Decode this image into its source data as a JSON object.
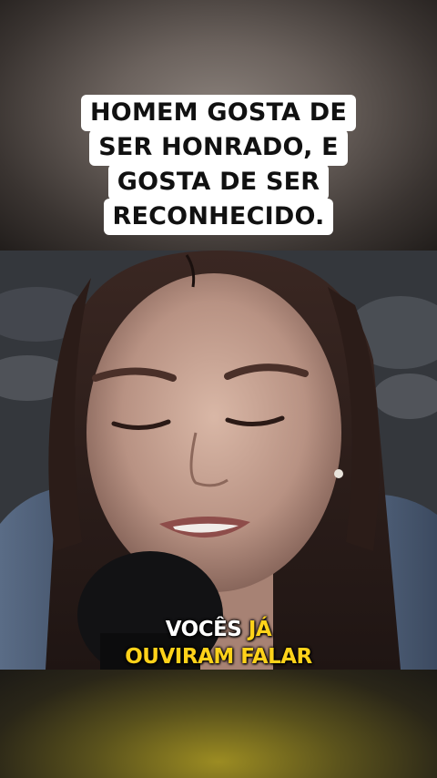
{
  "caption": {
    "lines": [
      "HOMEM GOSTA DE",
      "SER HONRADO, E",
      "GOSTA DE SER",
      "RECONHECIDO."
    ]
  },
  "subtitle": {
    "line1_white": "VOCÊS",
    "line1_yellow": "JÁ",
    "line2_yellow": "OUVIRAM FALAR"
  },
  "colors": {
    "subtitle_highlight": "#ffd21a",
    "caption_background": "#ffffff"
  }
}
